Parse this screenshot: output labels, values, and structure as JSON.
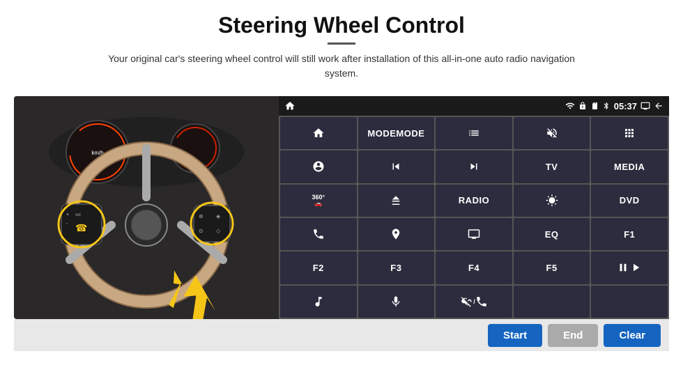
{
  "page": {
    "title": "Steering Wheel Control",
    "subtitle": "Your original car's steering wheel control will still work after installation of this all-in-one auto radio navigation system."
  },
  "status_bar": {
    "time": "05:37",
    "icons": [
      "wifi",
      "lock",
      "sd",
      "bt",
      "screen",
      "back"
    ]
  },
  "grid_buttons": [
    {
      "id": "r1c1",
      "type": "icon",
      "icon": "home",
      "label": ""
    },
    {
      "id": "r1c2",
      "type": "text",
      "label": "MODE"
    },
    {
      "id": "r1c3",
      "type": "icon",
      "icon": "list",
      "label": ""
    },
    {
      "id": "r1c4",
      "type": "icon",
      "icon": "mute",
      "label": ""
    },
    {
      "id": "r1c5",
      "type": "icon",
      "icon": "apps",
      "label": ""
    },
    {
      "id": "r2c1",
      "type": "icon",
      "icon": "settings-circle",
      "label": ""
    },
    {
      "id": "r2c2",
      "type": "icon",
      "icon": "prev",
      "label": ""
    },
    {
      "id": "r2c3",
      "type": "icon",
      "icon": "next",
      "label": ""
    },
    {
      "id": "r2c4",
      "type": "text",
      "label": "TV"
    },
    {
      "id": "r2c5",
      "type": "text",
      "label": "MEDIA"
    },
    {
      "id": "r3c1",
      "type": "icon",
      "icon": "360cam",
      "label": ""
    },
    {
      "id": "r3c2",
      "type": "icon",
      "icon": "eject",
      "label": ""
    },
    {
      "id": "r3c3",
      "type": "text",
      "label": "RADIO"
    },
    {
      "id": "r3c4",
      "type": "icon",
      "icon": "brightness",
      "label": ""
    },
    {
      "id": "r3c5",
      "type": "text",
      "label": "DVD"
    },
    {
      "id": "r4c1",
      "type": "icon",
      "icon": "phone",
      "label": ""
    },
    {
      "id": "r4c2",
      "type": "icon",
      "icon": "navi",
      "label": ""
    },
    {
      "id": "r4c3",
      "type": "icon",
      "icon": "display",
      "label": ""
    },
    {
      "id": "r4c4",
      "type": "text",
      "label": "EQ"
    },
    {
      "id": "r4c5",
      "type": "text",
      "label": "F1"
    },
    {
      "id": "r5c1",
      "type": "text",
      "label": "F2"
    },
    {
      "id": "r5c2",
      "type": "text",
      "label": "F3"
    },
    {
      "id": "r5c3",
      "type": "text",
      "label": "F4"
    },
    {
      "id": "r5c4",
      "type": "text",
      "label": "F5"
    },
    {
      "id": "r5c5",
      "type": "icon",
      "icon": "playpause",
      "label": ""
    },
    {
      "id": "r6c1",
      "type": "icon",
      "icon": "music",
      "label": ""
    },
    {
      "id": "r6c2",
      "type": "icon",
      "icon": "microphone",
      "label": ""
    },
    {
      "id": "r6c3",
      "type": "icon",
      "icon": "vol-phone",
      "label": ""
    },
    {
      "id": "r6c4",
      "type": "empty",
      "label": ""
    },
    {
      "id": "r6c5",
      "type": "empty",
      "label": ""
    }
  ],
  "bottom_buttons": {
    "start_label": "Start",
    "end_label": "End",
    "clear_label": "Clear"
  }
}
